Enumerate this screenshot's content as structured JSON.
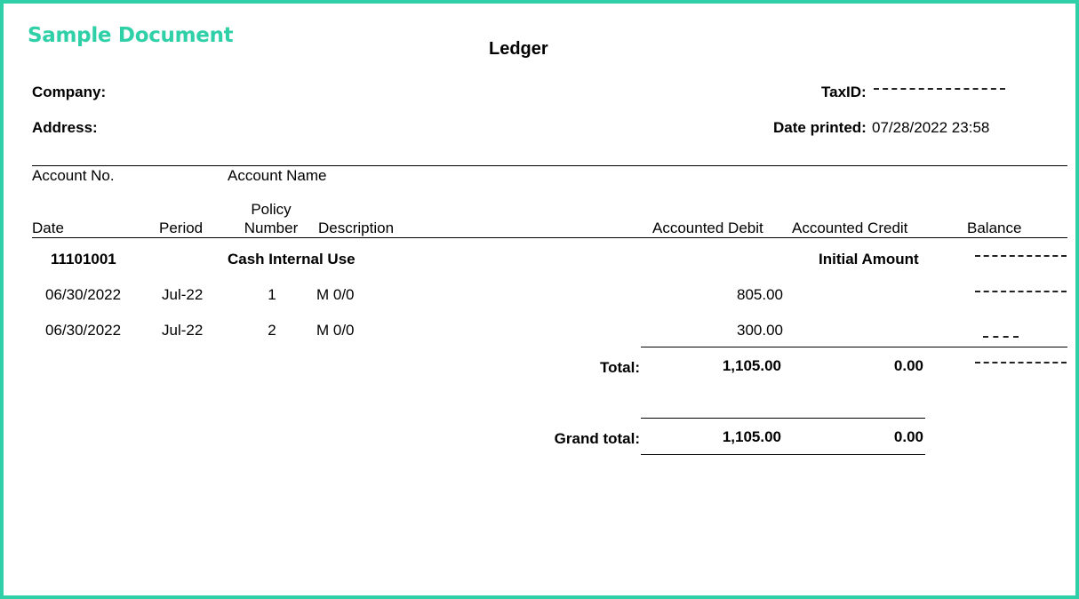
{
  "watermark": "Sample Document",
  "title": "Ledger",
  "header": {
    "company_label": "Company:",
    "address_label": "Address:",
    "taxid_label": "TaxID:",
    "date_printed_label": "Date printed:",
    "date_printed_value": "07/28/2022 23:58"
  },
  "columns": {
    "account_no": "Account No.",
    "account_name": "Account Name",
    "date": "Date",
    "period": "Period",
    "policy_number_line1": "Policy",
    "policy_number_line2": "Number",
    "description": "Description",
    "accounted_debit": "Accounted Debit",
    "accounted_credit": "Accounted Credit",
    "balance": "Balance"
  },
  "account": {
    "number": "11101001",
    "name": "Cash Internal Use",
    "initial_label": "Initial Amount"
  },
  "rows": [
    {
      "date": "06/30/2022",
      "period": "Jul-22",
      "policy": "1",
      "description": "M 0/0",
      "debit": "805.00"
    },
    {
      "date": "06/30/2022",
      "period": "Jul-22",
      "policy": "2",
      "description": "M 0/0",
      "debit": "300.00"
    }
  ],
  "total": {
    "label": "Total:",
    "debit": "1,105.00",
    "credit": "0.00"
  },
  "grand_total": {
    "label": "Grand total:",
    "debit": "1,105.00",
    "credit": "0.00"
  }
}
